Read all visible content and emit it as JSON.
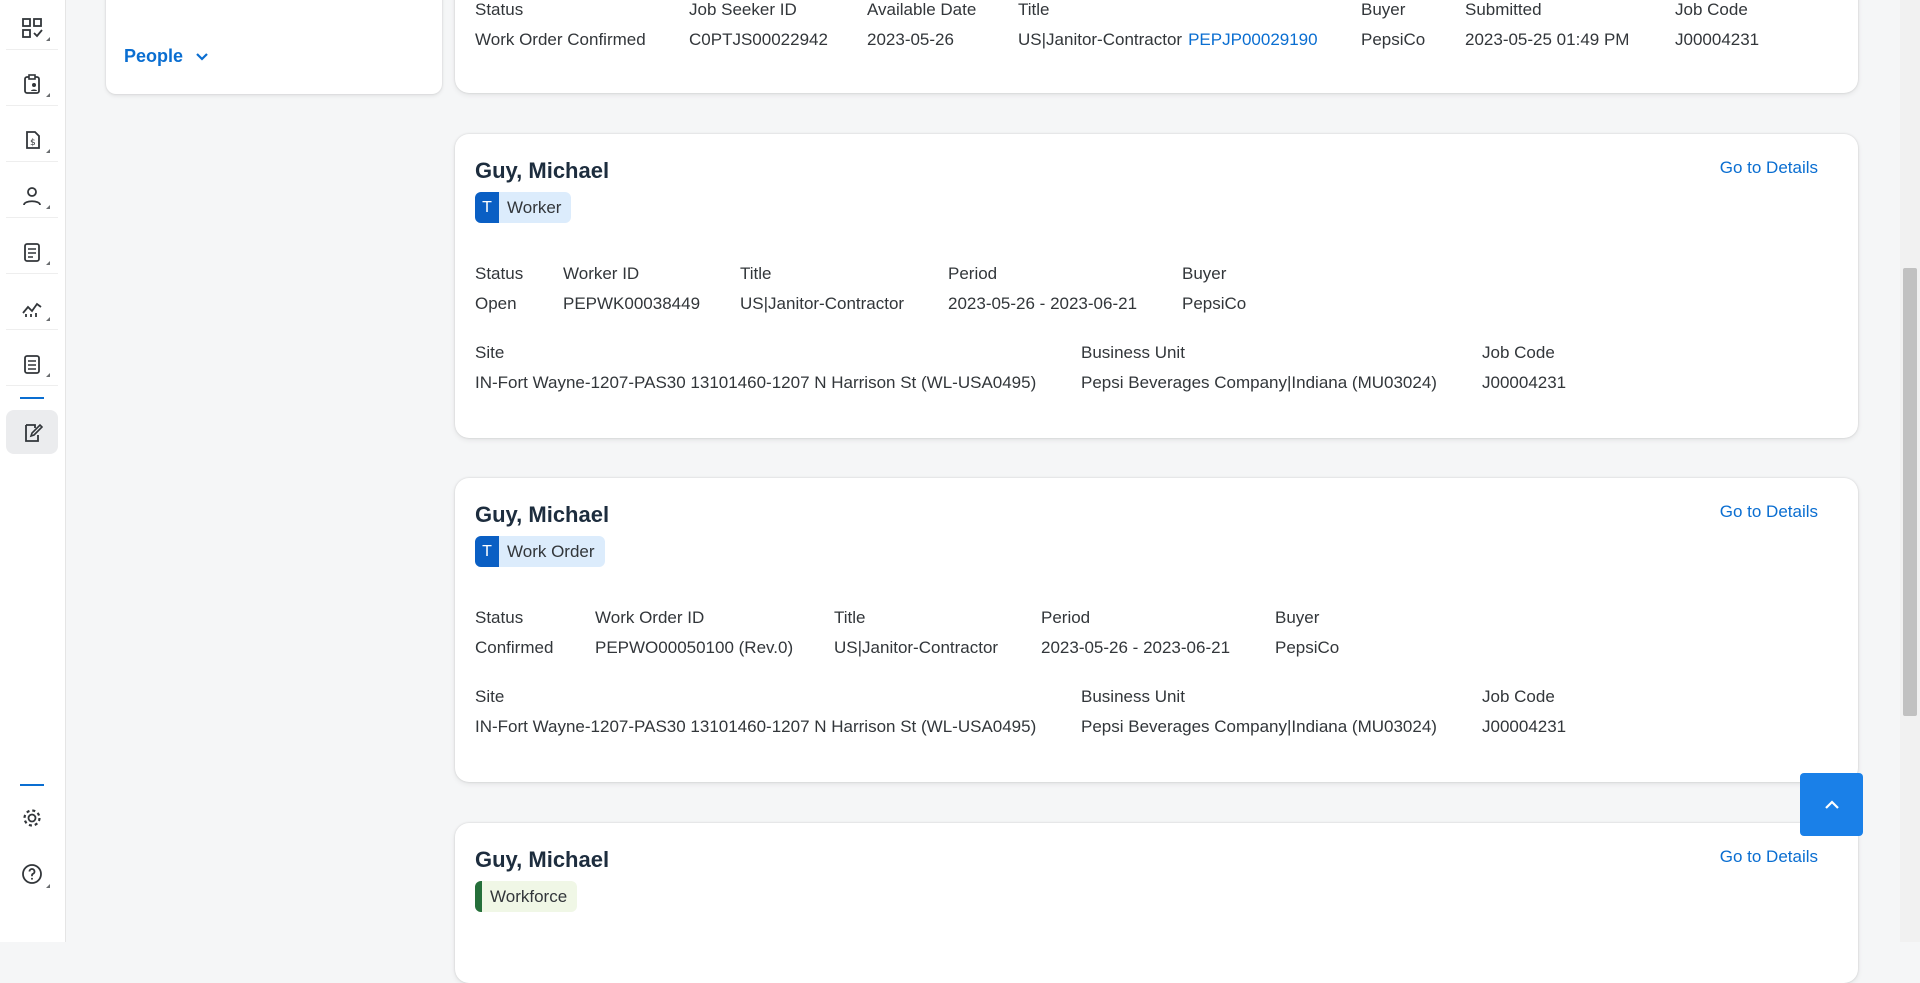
{
  "filter_panel": {
    "people_label": "People"
  },
  "top_card": {
    "fields": [
      {
        "label": "Status",
        "value": "Work Order Confirmed"
      },
      {
        "label": "Job Seeker ID",
        "value": "C0PTJS00022942"
      },
      {
        "label": "Available Date",
        "value": "2023-05-26"
      },
      {
        "label": "Title",
        "value": "US|Janitor-Contractor",
        "link": "PEPJP00029190"
      },
      {
        "label": "Buyer",
        "value": "PepsiCo"
      },
      {
        "label": "Submitted",
        "value": "2023-05-25 01:49 PM"
      },
      {
        "label": "Job Code",
        "value": "J00004231"
      }
    ]
  },
  "cards": [
    {
      "name": "Guy, Michael",
      "details_label": "Go to Details",
      "badge": {
        "letter": "T",
        "label": "Worker"
      },
      "row1": [
        {
          "label": "Status",
          "value": "Open"
        },
        {
          "label": "Worker ID",
          "value": "PEPWK00038449"
        },
        {
          "label": "Title",
          "value": "US|Janitor-Contractor"
        },
        {
          "label": "Period",
          "value": "2023-05-26 - 2023-06-21"
        },
        {
          "label": "Buyer",
          "value": "PepsiCo"
        }
      ],
      "row2": [
        {
          "label": "Site",
          "value": "IN-Fort Wayne-1207-PAS30 13101460-1207 N Harrison St (WL-USA0495)"
        },
        {
          "label": "Business Unit",
          "value": "Pepsi Beverages Company|Indiana (MU03024)"
        },
        {
          "label": "Job Code",
          "value": "J00004231"
        }
      ]
    },
    {
      "name": "Guy, Michael",
      "details_label": "Go to Details",
      "badge": {
        "letter": "T",
        "label": "Work Order"
      },
      "row1": [
        {
          "label": "Status",
          "value": "Confirmed"
        },
        {
          "label": "Work Order ID",
          "value": "PEPWO00050100 (Rev.0)"
        },
        {
          "label": "Title",
          "value": "US|Janitor-Contractor"
        },
        {
          "label": "Period",
          "value": "2023-05-26 - 2023-06-21"
        },
        {
          "label": "Buyer",
          "value": "PepsiCo"
        }
      ],
      "row2": [
        {
          "label": "Site",
          "value": "IN-Fort Wayne-1207-PAS30 13101460-1207 N Harrison St (WL-USA0495)"
        },
        {
          "label": "Business Unit",
          "value": "Pepsi Beverages Company|Indiana (MU03024)"
        },
        {
          "label": "Job Code",
          "value": "J00004231"
        }
      ]
    },
    {
      "name": "Guy, Michael",
      "details_label": "Go to Details",
      "badge": {
        "label": "Workforce"
      }
    }
  ],
  "rail_icons": [
    "qr-grid-icon",
    "clipboard-person-icon",
    "invoice-dollar-icon",
    "person-icon",
    "list-document-icon",
    "line-chart-icon",
    "report-document-icon",
    "edit-document-icon",
    "settings-icon",
    "help-icon"
  ],
  "colors": {
    "accent": "#0a6ed1",
    "worker_badge": "#dcecfc",
    "workforce_bar": "#256f3a",
    "scroll_top": "#1a80e8"
  }
}
